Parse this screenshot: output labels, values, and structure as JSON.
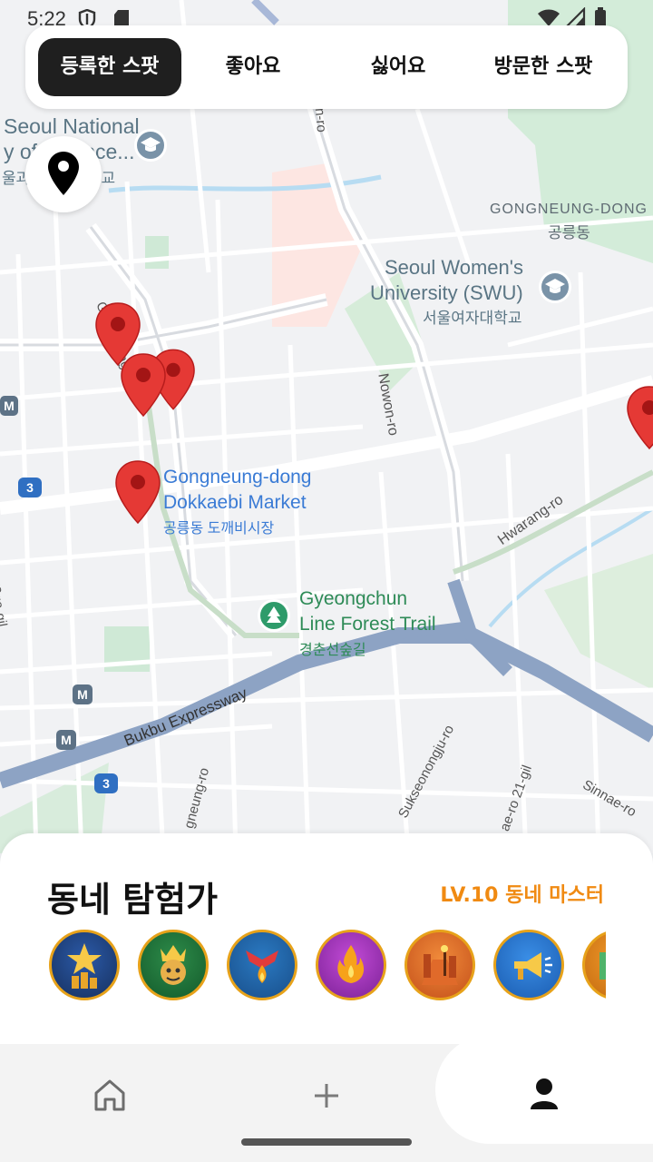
{
  "status_bar": {
    "time": "5:22"
  },
  "tabs": [
    {
      "label": "등록한 스팟",
      "active": true
    },
    {
      "label": "좋아요",
      "active": false
    },
    {
      "label": "싫어요",
      "active": false
    },
    {
      "label": "방문한 스팟",
      "active": false
    }
  ],
  "map": {
    "labels": {
      "snu_en": "Seoul National",
      "snu_en2": "y of Science...",
      "snu_ko": "울과학기술대학교",
      "gongneung_dong_en": "GONGNEUNG-DONG",
      "gongneung_dong_ko": "공릉동",
      "swu_en1": "Seoul Women's",
      "swu_en2": "University (SWU)",
      "swu_ko": "서울여자대학교",
      "dokkaebi_en1": "Gongneung-dong",
      "dokkaebi_en2": "Dokkaebi Market",
      "dokkaebi_ko": "공릉동 도깨비시장",
      "trail_en1": "Gyeongchun",
      "trail_en2": "Line Forest Trail",
      "trail_ko": "경춘선숲길",
      "road_gongneung_ro": "Gongneung-ro",
      "road_gongneung_ro_2": "gneung-ro",
      "road_nowon_ro": "Nowon-ro",
      "road_nowon_ro_top": "on-ro",
      "road_hwarang_ro": "Hwarang-ro",
      "road_bukbu": "Bukbu Expressway",
      "road_sukseong": "Sukseonongju-ro",
      "road_sinnae": "Sinnae-ro",
      "road_21gil": "ae-ro 21-gil",
      "road_173": "173ga-gil",
      "route_3a": "3",
      "route_3b": "3",
      "metro": "M"
    }
  },
  "sheet": {
    "title": "동네 탐험가",
    "level": "LV.10 동네 마스터",
    "badge_icons": [
      "star-city-badge",
      "king-badge",
      "explorer-badge",
      "fire-badge",
      "alley-badge",
      "megaphone-badge",
      "map-badge"
    ]
  },
  "nav": {
    "items": [
      {
        "name": "home",
        "icon": "home-icon"
      },
      {
        "name": "add",
        "icon": "plus-icon"
      },
      {
        "name": "profile",
        "icon": "person-icon"
      }
    ]
  },
  "colors": {
    "accent": "#f08a12",
    "pin": "#e53935",
    "active_tab": "#1f1f1f"
  }
}
